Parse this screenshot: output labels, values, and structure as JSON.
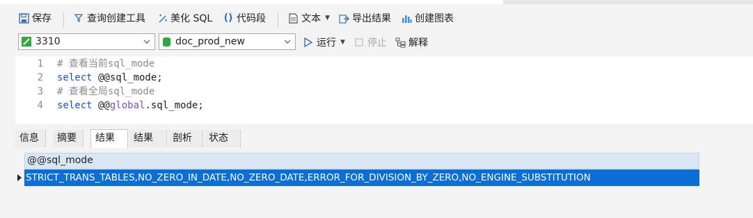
{
  "toolbar": {
    "save": "保存",
    "query_builder": "查询创建工具",
    "beautify_sql": "美化 SQL",
    "code_snippet": "代码段",
    "text": "文本",
    "export_results": "导出结果",
    "create_chart": "创建图表"
  },
  "connection": {
    "name": "3310",
    "database": "doc_prod_new"
  },
  "run_bar": {
    "run": "运行",
    "stop": "停止",
    "explain": "解释"
  },
  "editor": {
    "lines": [
      {
        "num": "1",
        "text": "# 查看当前sql_mode"
      },
      {
        "num": "2",
        "kw": "select",
        "rest": " @@sql_mode;"
      },
      {
        "num": "3",
        "text": "# 查看全局sql_mode"
      },
      {
        "num": "4",
        "kw": "select",
        "pre": " @@",
        "global": "global",
        "rest": ".sql_mode;"
      }
    ]
  },
  "tabs": [
    "信息",
    "摘要",
    "结果 1",
    "结果 2",
    "剖析",
    "状态"
  ],
  "result": {
    "column": "@@sql_mode",
    "value": "STRICT_TRANS_TABLES,NO_ZERO_IN_DATE,NO_ZERO_DATE,ERROR_FOR_DIVISION_BY_ZERO,NO_ENGINE_SUBSTITUTION"
  },
  "colors": {
    "selection": "#0b6fd6",
    "header": "#d9e6f3",
    "keyword": "#1750eb",
    "comment": "#8c8c8c",
    "connection_green": "#2eaa3c"
  }
}
